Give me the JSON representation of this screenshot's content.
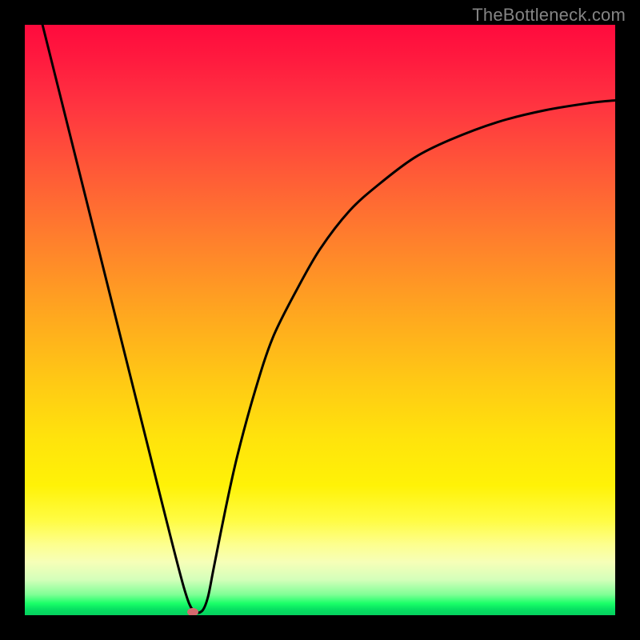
{
  "watermark": "TheBottleneck.com",
  "chart_data": {
    "type": "line",
    "title": "",
    "xlabel": "",
    "ylabel": "",
    "xlim": [
      0,
      100
    ],
    "ylim": [
      0,
      100
    ],
    "series": [
      {
        "name": "curve",
        "x": [
          3,
          6,
          9,
          12,
          15,
          18,
          21,
          24,
          27,
          28.5,
          30,
          31,
          32,
          34,
          36,
          39,
          42,
          46,
          50,
          55,
          60,
          66,
          72,
          80,
          88,
          96,
          100
        ],
        "y": [
          100,
          88,
          76,
          64,
          52,
          40,
          28,
          16,
          4.5,
          0.8,
          0.7,
          3,
          8,
          18,
          27,
          38,
          47,
          55,
          62,
          68.5,
          73,
          77.5,
          80.5,
          83.5,
          85.5,
          86.8,
          87.2
        ]
      }
    ],
    "marker": {
      "x": 28.5,
      "y": 0.5,
      "color": "#d56a6f"
    },
    "gradient_stops": [
      {
        "pct": 0,
        "color": "#ff0a3d"
      },
      {
        "pct": 25,
        "color": "#ff5a37"
      },
      {
        "pct": 50,
        "color": "#ffa420"
      },
      {
        "pct": 75,
        "color": "#fff207"
      },
      {
        "pct": 95,
        "color": "#80ff96"
      },
      {
        "pct": 100,
        "color": "#06d05e"
      }
    ]
  }
}
